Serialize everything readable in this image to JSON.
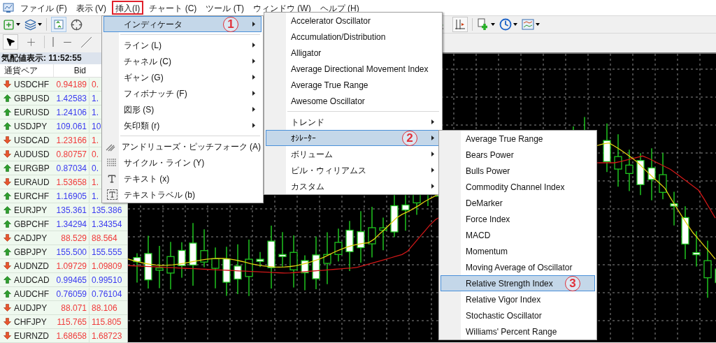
{
  "menu_bar": {
    "items": [
      {
        "label": "ファイル (F)",
        "selected": false
      },
      {
        "label": "表示 (V)",
        "selected": false
      },
      {
        "label": "挿入(I)",
        "selected": true
      },
      {
        "label": "チャート (C)",
        "selected": false
      },
      {
        "label": "ツール (T)",
        "selected": false
      },
      {
        "label": "ウィンドウ (W)",
        "selected": false
      },
      {
        "label": "ヘルプ (H)",
        "selected": false
      }
    ]
  },
  "market_watch": {
    "title": "気配値表示: 11:52:55",
    "columns": [
      "通貨ペア",
      "Bid"
    ],
    "rows": [
      {
        "symbol": "USDCHF",
        "bid": "0.94189",
        "ask": "0.",
        "rising": false
      },
      {
        "symbol": "GBPUSD",
        "bid": "1.42583",
        "ask": "1.",
        "rising": true
      },
      {
        "symbol": "EURUSD",
        "bid": "1.24106",
        "ask": "1.",
        "rising": true
      },
      {
        "symbol": "USDJPY",
        "bid": "109.061",
        "ask": "10",
        "rising": true
      },
      {
        "symbol": "USDCAD",
        "bid": "1.23166",
        "ask": "1.",
        "rising": false
      },
      {
        "symbol": "AUDUSD",
        "bid": "0.80757",
        "ask": "0.",
        "rising": false
      },
      {
        "symbol": "EURGBP",
        "bid": "0.87034",
        "ask": "0.",
        "rising": true
      },
      {
        "symbol": "EURAUD",
        "bid": "1.53658",
        "ask": "1.",
        "rising": false
      },
      {
        "symbol": "EURCHF",
        "bid": "1.16905",
        "ask": "1.",
        "rising": true
      },
      {
        "symbol": "EURJPY",
        "bid": "135.361",
        "ask": "135.386",
        "rising": true
      },
      {
        "symbol": "GBPCHF",
        "bid": "1.34294",
        "ask": "1.34354",
        "rising": true
      },
      {
        "symbol": "CADJPY",
        "bid": "88.529",
        "ask": "88.564",
        "rising": false
      },
      {
        "symbol": "GBPJPY",
        "bid": "155.500",
        "ask": "155.555",
        "rising": true
      },
      {
        "symbol": "AUDNZD",
        "bid": "1.09729",
        "ask": "1.09809",
        "rising": false
      },
      {
        "symbol": "AUDCAD",
        "bid": "0.99465",
        "ask": "0.99510",
        "rising": true
      },
      {
        "symbol": "AUDCHF",
        "bid": "0.76059",
        "ask": "0.76104",
        "rising": true
      },
      {
        "symbol": "AUDJPY",
        "bid": "88.071",
        "ask": "88.106",
        "rising": false
      },
      {
        "symbol": "CHFJPY",
        "bid": "115.765",
        "ask": "115.805",
        "rising": false
      },
      {
        "symbol": "EURNZD",
        "bid": "1.68658",
        "ask": "1.68723",
        "rising": false
      }
    ]
  },
  "insert_menu": {
    "items": [
      {
        "kind": "submenu",
        "label": "インディケータ",
        "selected": true,
        "annotation": "1"
      },
      {
        "kind": "separator"
      },
      {
        "kind": "submenu",
        "label": "ライン (L)",
        "selected": false
      },
      {
        "kind": "submenu",
        "label": "チャネル (C)",
        "selected": false
      },
      {
        "kind": "submenu",
        "label": "ギャン (G)",
        "selected": false
      },
      {
        "kind": "submenu",
        "label": "フィボナッチ (F)",
        "selected": false
      },
      {
        "kind": "submenu",
        "label": "図形 (S)",
        "selected": false
      },
      {
        "kind": "submenu",
        "label": "矢印類 (r)",
        "selected": false
      },
      {
        "kind": "separator"
      },
      {
        "kind": "tool",
        "label": "アンドリューズ・ピッチフォーク (A)",
        "selected": false
      },
      {
        "kind": "tool",
        "label": "サイクル・ライン (Y)",
        "selected": false
      },
      {
        "kind": "tool",
        "label": "テキスト (x)",
        "selected": false
      },
      {
        "kind": "tool",
        "label": "テキストラベル (b)",
        "selected": false
      }
    ]
  },
  "indicators_menu": {
    "items": [
      {
        "kind": "item",
        "label": "Accelerator Oscillator",
        "selected": false
      },
      {
        "kind": "item",
        "label": "Accumulation/Distribution",
        "selected": false
      },
      {
        "kind": "item",
        "label": "Alligator",
        "selected": false
      },
      {
        "kind": "item",
        "label": "Average Directional Movement Index",
        "selected": false
      },
      {
        "kind": "item",
        "label": "Average True Range",
        "selected": false
      },
      {
        "kind": "item",
        "label": "Awesome Oscillator",
        "selected": false
      },
      {
        "kind": "separator"
      },
      {
        "kind": "submenu",
        "label": "トレンド",
        "selected": false
      },
      {
        "kind": "submenu",
        "label": "ｵｼﾚｰﾀｰ",
        "selected": true,
        "annotation": "2"
      },
      {
        "kind": "submenu",
        "label": "ボリューム",
        "selected": false
      },
      {
        "kind": "submenu",
        "label": "ビル・ウィリアムス",
        "selected": false
      },
      {
        "kind": "submenu",
        "label": "カスタム",
        "selected": false
      }
    ]
  },
  "oscillators_menu": {
    "items": [
      {
        "kind": "item",
        "label": "Average True Range",
        "selected": false
      },
      {
        "kind": "item",
        "label": "Bears Power",
        "selected": false
      },
      {
        "kind": "item",
        "label": "Bulls Power",
        "selected": false
      },
      {
        "kind": "item",
        "label": "Commodity Channel Index",
        "selected": false
      },
      {
        "kind": "item",
        "label": "DeMarker",
        "selected": false
      },
      {
        "kind": "item",
        "label": "Force Index",
        "selected": false
      },
      {
        "kind": "item",
        "label": "MACD",
        "selected": false
      },
      {
        "kind": "item",
        "label": "Momentum",
        "selected": false
      },
      {
        "kind": "item",
        "label": "Moving Average of Oscillator",
        "selected": false
      },
      {
        "kind": "item",
        "label": "Relative Strength Index",
        "selected": true,
        "annotation": "3"
      },
      {
        "kind": "item",
        "label": "Relative Vigor Index",
        "selected": false
      },
      {
        "kind": "item",
        "label": "Stochastic Oscillator",
        "selected": false
      },
      {
        "kind": "item",
        "label": "Williams' Percent Range",
        "selected": false
      }
    ]
  }
}
